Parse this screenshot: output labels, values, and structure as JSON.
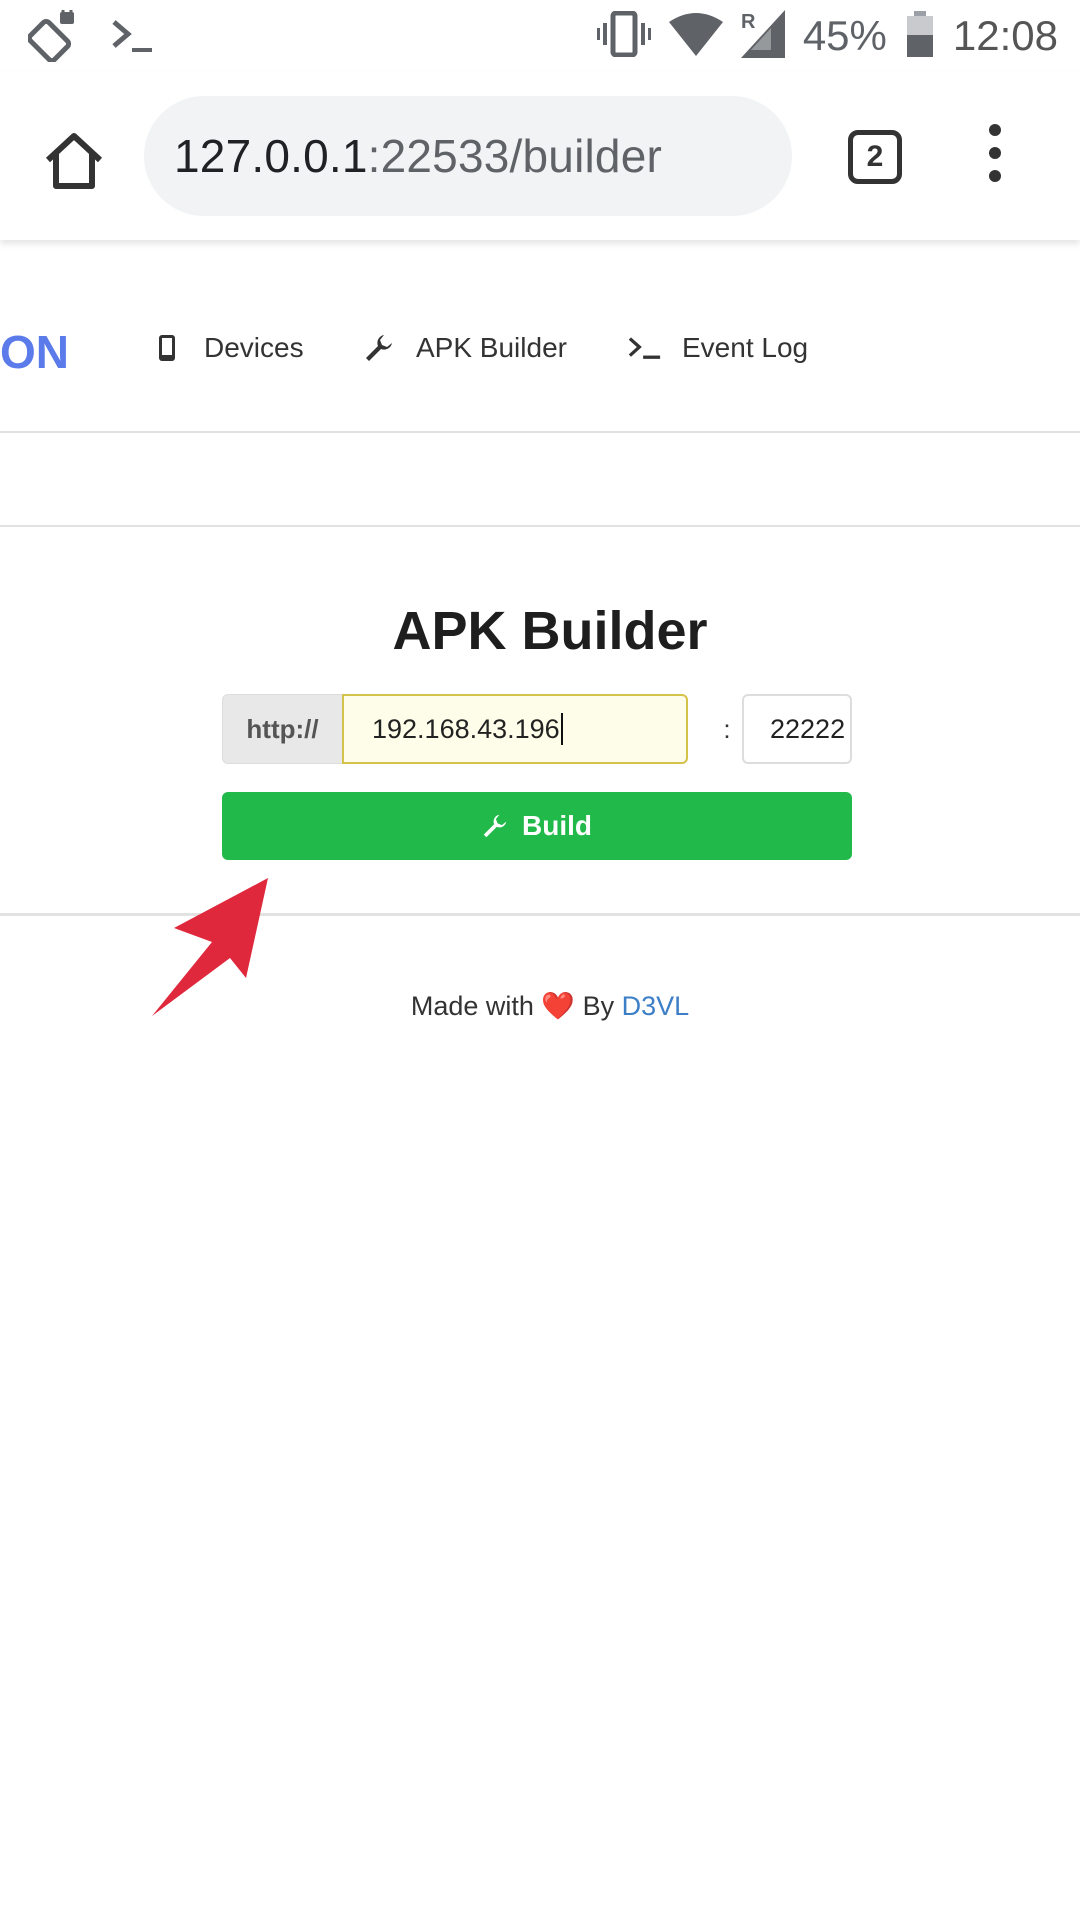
{
  "status_bar": {
    "battery": "45%",
    "time": "12:08",
    "icons": [
      "screen-rotation-icon",
      "terminal-icon",
      "vibrate-icon",
      "wifi-icon",
      "signal-roaming-icon",
      "battery-icon"
    ]
  },
  "browser": {
    "url_host": "127.0.0.1",
    "url_path": ":22533/builder",
    "tab_count": "2"
  },
  "nav": {
    "brand": "ON",
    "items": [
      {
        "label": "Devices",
        "icon": "phone-icon"
      },
      {
        "label": "APK Builder",
        "icon": "wrench-icon"
      },
      {
        "label": "Event Log",
        "icon": "terminal-icon"
      }
    ]
  },
  "builder": {
    "title": "APK Builder",
    "prefix": "http://",
    "host_value": "192.168.43.196",
    "separator": ":",
    "port_value": "22222",
    "build_label": "Build"
  },
  "footer": {
    "made_with": "Made with",
    "by": "By",
    "author": "D3VL"
  },
  "colors": {
    "brand": "#5b7bea",
    "build_button": "#21b94a",
    "link": "#3c7fc6",
    "arrow": "#e0283c"
  }
}
